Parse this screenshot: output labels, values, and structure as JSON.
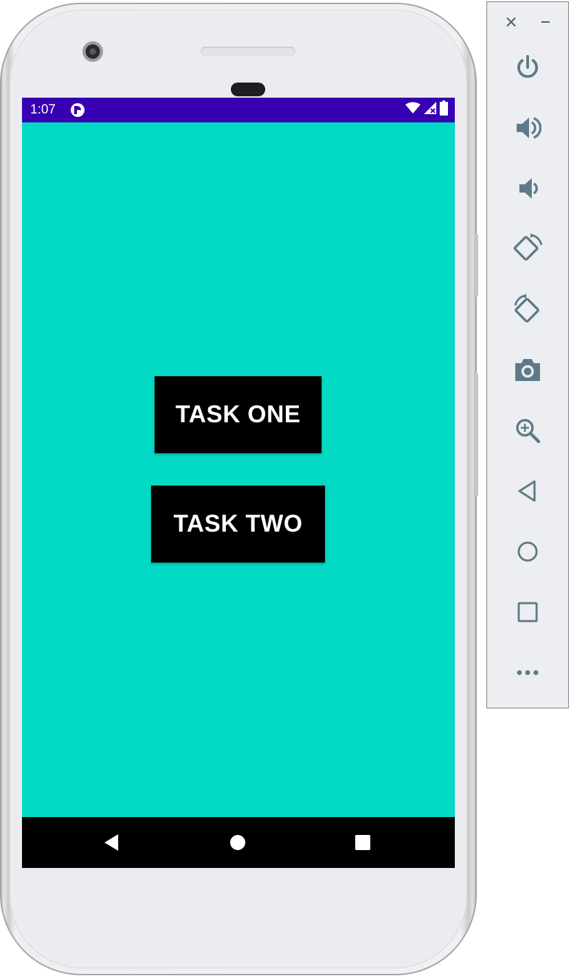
{
  "device": {
    "status_bar": {
      "time": "1:07",
      "background": "#3700b3",
      "icons": [
        "app-notification-icon",
        "wifi-icon",
        "signal-no-data-icon",
        "battery-icon"
      ]
    },
    "screen": {
      "background": "#03dac5",
      "buttons": [
        {
          "label": "TASK ONE"
        },
        {
          "label": "TASK TWO"
        }
      ]
    },
    "nav_bar": {
      "background": "#000000",
      "icons": [
        "back-icon",
        "home-icon",
        "recents-icon"
      ]
    }
  },
  "emulator_toolbar": {
    "window_controls": [
      "close-icon",
      "minimize-icon"
    ],
    "items": [
      {
        "icon": "power-icon"
      },
      {
        "icon": "volume-up-icon"
      },
      {
        "icon": "volume-down-icon"
      },
      {
        "icon": "rotate-left-icon"
      },
      {
        "icon": "rotate-right-icon"
      },
      {
        "icon": "camera-icon"
      },
      {
        "icon": "zoom-icon"
      },
      {
        "icon": "back-icon"
      },
      {
        "icon": "home-icon"
      },
      {
        "icon": "overview-icon"
      },
      {
        "icon": "more-icon"
      }
    ],
    "icon_color": "#5f7a87"
  }
}
